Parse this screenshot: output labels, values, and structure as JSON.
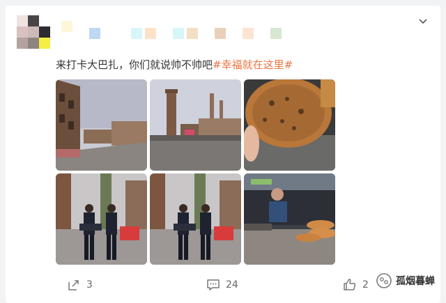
{
  "post": {
    "text": "来打卡大巴扎，你们就说帅不帅吧",
    "hashtag": "#幸福就在这里#",
    "photos": [
      {
        "name": "photo-bazaar-street-left"
      },
      {
        "name": "photo-bazaar-tower"
      },
      {
        "name": "photo-naan-bread"
      },
      {
        "name": "photo-police-pair-1"
      },
      {
        "name": "photo-police-pair-2"
      },
      {
        "name": "photo-naan-vendor"
      }
    ]
  },
  "actions": {
    "share_count": "3",
    "comment_count": "24",
    "like_count": "2"
  },
  "watermark": {
    "label": "孤烟暮蝉"
  },
  "colors": {
    "hashtag": "#eb7340",
    "text": "#333333",
    "muted": "#666666",
    "background": "#f2f3f5"
  }
}
